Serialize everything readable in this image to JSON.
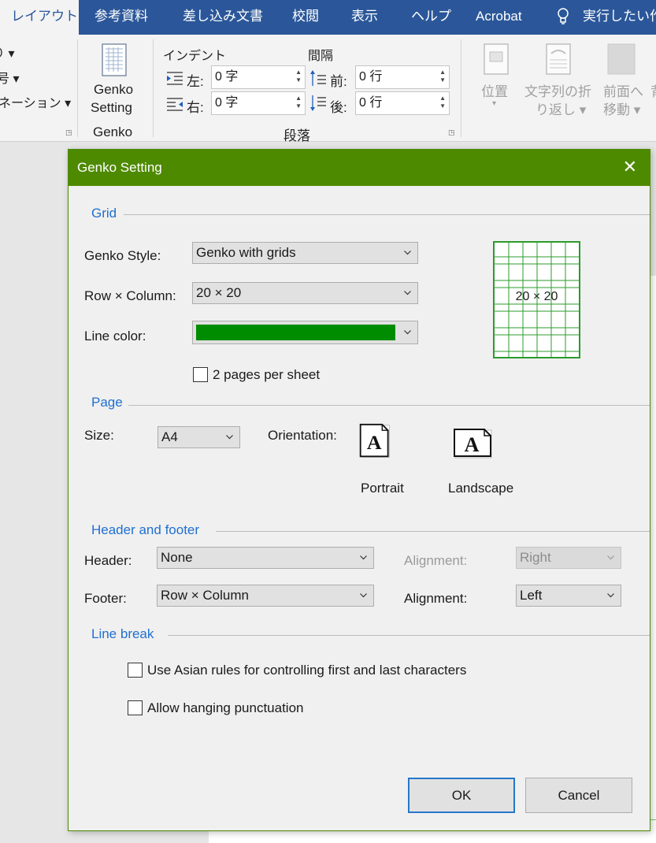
{
  "ribbon": {
    "tabs": [
      {
        "label": "レイアウト",
        "active": true
      },
      {
        "label": "参考資料"
      },
      {
        "label": "差し込み文書"
      },
      {
        "label": "校閲"
      },
      {
        "label": "表示"
      },
      {
        "label": "ヘルプ"
      },
      {
        "label": "Acrobat"
      },
      {
        "label": "実行したい作"
      }
    ],
    "left_items": [
      "り ▾",
      "号 ▾",
      "ネーション ▾"
    ],
    "genko_button": "Genko\nSetting",
    "genko_line1": "Genko",
    "genko_line2": "Setting",
    "genko_group": "Genko",
    "indent_label": "インデント",
    "spacing_label": "間隔",
    "left_label": "左:",
    "right_label": "右:",
    "before_label": "前:",
    "after_label": "後:",
    "left_value": "0 字",
    "right_value": "0 字",
    "before_value": "0 行",
    "after_value": "0 行",
    "paragraph_group": "段落",
    "position_label": "位置",
    "wrap_line1": "文字列の折",
    "wrap_line2": "り返し ▾",
    "front_line1": "前面へ",
    "front_line2": "移動 ▾",
    "cut_label": "背"
  },
  "dialog": {
    "title": "Genko Setting",
    "grid_section": "Grid",
    "genko_style_label": "Genko Style:",
    "genko_style_value": "Genko with grids",
    "row_col_label": "Row × Column:",
    "row_col_value": "20 × 20",
    "line_color_label": "Line color:",
    "line_color": "#008c00",
    "two_pages_label": "2 pages per sheet",
    "two_pages_checked": false,
    "preview_text": "20 × 20",
    "page_section": "Page",
    "size_label": "Size:",
    "size_value": "A4",
    "orientation_label": "Orientation:",
    "portrait_label": "Portrait",
    "landscape_label": "Landscape",
    "header_footer_section": "Header and footer",
    "header_label": "Header:",
    "header_value": "None",
    "header_alignment_label": "Alignment:",
    "header_alignment_value": "Right",
    "footer_label": "Footer:",
    "footer_value": "Row × Column",
    "footer_alignment_label": "Alignment:",
    "footer_alignment_value": "Left",
    "line_break_section": "Line break",
    "asian_rules_label": "Use Asian rules for controlling first and last characters",
    "asian_rules_checked": false,
    "hanging_label": "Allow hanging punctuation",
    "hanging_checked": false,
    "ok_label": "OK",
    "cancel_label": "Cancel"
  },
  "colors": {
    "ribbon_blue": "#2b579a",
    "dialog_title_green": "#4e8a00",
    "section_blue": "#1f6fd1",
    "grid_green": "#2b9b2b"
  }
}
